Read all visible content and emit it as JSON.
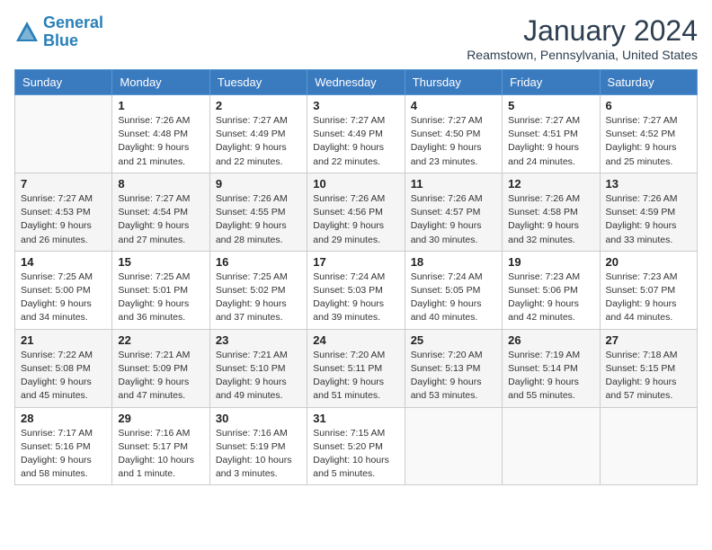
{
  "header": {
    "logo_line1": "General",
    "logo_line2": "Blue",
    "month": "January 2024",
    "location": "Reamstown, Pennsylvania, United States"
  },
  "weekdays": [
    "Sunday",
    "Monday",
    "Tuesday",
    "Wednesday",
    "Thursday",
    "Friday",
    "Saturday"
  ],
  "weeks": [
    [
      {
        "day": "",
        "sunrise": "",
        "sunset": "",
        "daylight": ""
      },
      {
        "day": "1",
        "sunrise": "Sunrise: 7:26 AM",
        "sunset": "Sunset: 4:48 PM",
        "daylight": "Daylight: 9 hours and 21 minutes."
      },
      {
        "day": "2",
        "sunrise": "Sunrise: 7:27 AM",
        "sunset": "Sunset: 4:49 PM",
        "daylight": "Daylight: 9 hours and 22 minutes."
      },
      {
        "day": "3",
        "sunrise": "Sunrise: 7:27 AM",
        "sunset": "Sunset: 4:49 PM",
        "daylight": "Daylight: 9 hours and 22 minutes."
      },
      {
        "day": "4",
        "sunrise": "Sunrise: 7:27 AM",
        "sunset": "Sunset: 4:50 PM",
        "daylight": "Daylight: 9 hours and 23 minutes."
      },
      {
        "day": "5",
        "sunrise": "Sunrise: 7:27 AM",
        "sunset": "Sunset: 4:51 PM",
        "daylight": "Daylight: 9 hours and 24 minutes."
      },
      {
        "day": "6",
        "sunrise": "Sunrise: 7:27 AM",
        "sunset": "Sunset: 4:52 PM",
        "daylight": "Daylight: 9 hours and 25 minutes."
      }
    ],
    [
      {
        "day": "7",
        "sunrise": "Sunrise: 7:27 AM",
        "sunset": "Sunset: 4:53 PM",
        "daylight": "Daylight: 9 hours and 26 minutes."
      },
      {
        "day": "8",
        "sunrise": "Sunrise: 7:27 AM",
        "sunset": "Sunset: 4:54 PM",
        "daylight": "Daylight: 9 hours and 27 minutes."
      },
      {
        "day": "9",
        "sunrise": "Sunrise: 7:26 AM",
        "sunset": "Sunset: 4:55 PM",
        "daylight": "Daylight: 9 hours and 28 minutes."
      },
      {
        "day": "10",
        "sunrise": "Sunrise: 7:26 AM",
        "sunset": "Sunset: 4:56 PM",
        "daylight": "Daylight: 9 hours and 29 minutes."
      },
      {
        "day": "11",
        "sunrise": "Sunrise: 7:26 AM",
        "sunset": "Sunset: 4:57 PM",
        "daylight": "Daylight: 9 hours and 30 minutes."
      },
      {
        "day": "12",
        "sunrise": "Sunrise: 7:26 AM",
        "sunset": "Sunset: 4:58 PM",
        "daylight": "Daylight: 9 hours and 32 minutes."
      },
      {
        "day": "13",
        "sunrise": "Sunrise: 7:26 AM",
        "sunset": "Sunset: 4:59 PM",
        "daylight": "Daylight: 9 hours and 33 minutes."
      }
    ],
    [
      {
        "day": "14",
        "sunrise": "Sunrise: 7:25 AM",
        "sunset": "Sunset: 5:00 PM",
        "daylight": "Daylight: 9 hours and 34 minutes."
      },
      {
        "day": "15",
        "sunrise": "Sunrise: 7:25 AM",
        "sunset": "Sunset: 5:01 PM",
        "daylight": "Daylight: 9 hours and 36 minutes."
      },
      {
        "day": "16",
        "sunrise": "Sunrise: 7:25 AM",
        "sunset": "Sunset: 5:02 PM",
        "daylight": "Daylight: 9 hours and 37 minutes."
      },
      {
        "day": "17",
        "sunrise": "Sunrise: 7:24 AM",
        "sunset": "Sunset: 5:03 PM",
        "daylight": "Daylight: 9 hours and 39 minutes."
      },
      {
        "day": "18",
        "sunrise": "Sunrise: 7:24 AM",
        "sunset": "Sunset: 5:05 PM",
        "daylight": "Daylight: 9 hours and 40 minutes."
      },
      {
        "day": "19",
        "sunrise": "Sunrise: 7:23 AM",
        "sunset": "Sunset: 5:06 PM",
        "daylight": "Daylight: 9 hours and 42 minutes."
      },
      {
        "day": "20",
        "sunrise": "Sunrise: 7:23 AM",
        "sunset": "Sunset: 5:07 PM",
        "daylight": "Daylight: 9 hours and 44 minutes."
      }
    ],
    [
      {
        "day": "21",
        "sunrise": "Sunrise: 7:22 AM",
        "sunset": "Sunset: 5:08 PM",
        "daylight": "Daylight: 9 hours and 45 minutes."
      },
      {
        "day": "22",
        "sunrise": "Sunrise: 7:21 AM",
        "sunset": "Sunset: 5:09 PM",
        "daylight": "Daylight: 9 hours and 47 minutes."
      },
      {
        "day": "23",
        "sunrise": "Sunrise: 7:21 AM",
        "sunset": "Sunset: 5:10 PM",
        "daylight": "Daylight: 9 hours and 49 minutes."
      },
      {
        "day": "24",
        "sunrise": "Sunrise: 7:20 AM",
        "sunset": "Sunset: 5:11 PM",
        "daylight": "Daylight: 9 hours and 51 minutes."
      },
      {
        "day": "25",
        "sunrise": "Sunrise: 7:20 AM",
        "sunset": "Sunset: 5:13 PM",
        "daylight": "Daylight: 9 hours and 53 minutes."
      },
      {
        "day": "26",
        "sunrise": "Sunrise: 7:19 AM",
        "sunset": "Sunset: 5:14 PM",
        "daylight": "Daylight: 9 hours and 55 minutes."
      },
      {
        "day": "27",
        "sunrise": "Sunrise: 7:18 AM",
        "sunset": "Sunset: 5:15 PM",
        "daylight": "Daylight: 9 hours and 57 minutes."
      }
    ],
    [
      {
        "day": "28",
        "sunrise": "Sunrise: 7:17 AM",
        "sunset": "Sunset: 5:16 PM",
        "daylight": "Daylight: 9 hours and 58 minutes."
      },
      {
        "day": "29",
        "sunrise": "Sunrise: 7:16 AM",
        "sunset": "Sunset: 5:17 PM",
        "daylight": "Daylight: 10 hours and 1 minute."
      },
      {
        "day": "30",
        "sunrise": "Sunrise: 7:16 AM",
        "sunset": "Sunset: 5:19 PM",
        "daylight": "Daylight: 10 hours and 3 minutes."
      },
      {
        "day": "31",
        "sunrise": "Sunrise: 7:15 AM",
        "sunset": "Sunset: 5:20 PM",
        "daylight": "Daylight: 10 hours and 5 minutes."
      },
      {
        "day": "",
        "sunrise": "",
        "sunset": "",
        "daylight": ""
      },
      {
        "day": "",
        "sunrise": "",
        "sunset": "",
        "daylight": ""
      },
      {
        "day": "",
        "sunrise": "",
        "sunset": "",
        "daylight": ""
      }
    ]
  ]
}
